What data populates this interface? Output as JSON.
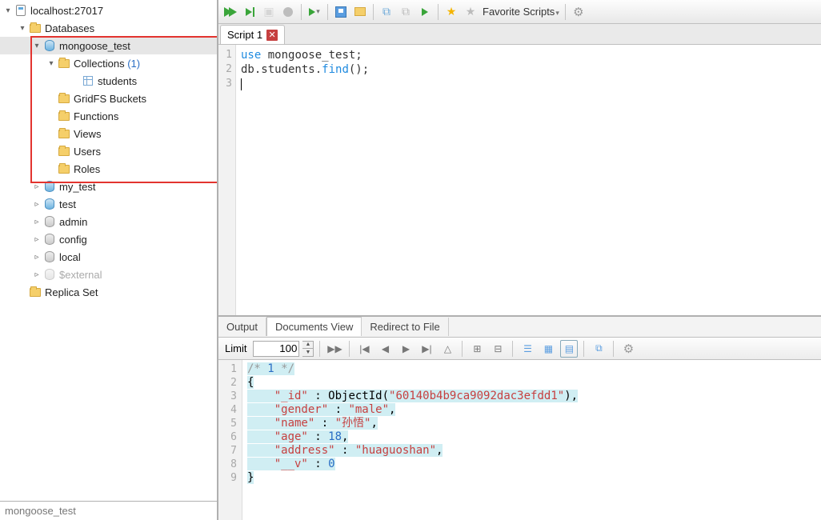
{
  "sidebar": {
    "root": {
      "label": "localhost:27017"
    },
    "databases_label": "Databases",
    "selected_db": "mongoose_test",
    "collections_label": "Collections",
    "collections_count": "(1)",
    "collection_items": [
      "students"
    ],
    "subfolders": [
      "GridFS Buckets",
      "Functions",
      "Views",
      "Users",
      "Roles"
    ],
    "other_dbs": [
      "my_test",
      "test",
      "admin",
      "config",
      "local",
      "$external"
    ],
    "replica_label": "Replica Set",
    "footer": "mongoose_test"
  },
  "toolbar": {
    "favorites_label": "Favorite Scripts"
  },
  "tabs": {
    "script_tab": "Script 1"
  },
  "editor": {
    "lines": [
      "1",
      "2",
      "3"
    ],
    "line1_a": "use",
    "line1_b": " mongoose_test;",
    "line2_a": "db.students.",
    "line2_b": "find",
    "line2_c": "();"
  },
  "lower_tabs": {
    "output": "Output",
    "docs": "Documents View",
    "redirect": "Redirect to File"
  },
  "limit": {
    "label": "Limit",
    "value": "100"
  },
  "result": {
    "gutter": [
      "1",
      "2",
      "3",
      "4",
      "5",
      "6",
      "7",
      "8",
      "9"
    ],
    "comment_a": "/* ",
    "comment_num": "1",
    "comment_b": " */",
    "brace_open": "{",
    "kv_id_k": "\"_id\"",
    "kv_id_sep": " : ObjectId(",
    "kv_id_v": "\"60140b4b9ca9092dac3efdd1\"",
    "kv_id_end": "),",
    "kv_gender_k": "\"gender\"",
    "kv_gender_v": "\"male\"",
    "kv_name_k": "\"name\"",
    "kv_name_v": "\"孙悟\"",
    "kv_age_k": "\"age\"",
    "kv_age_v": "18",
    "kv_address_k": "\"address\"",
    "kv_address_v": "\"huaguoshan\"",
    "kv_v_k": "\"__v\"",
    "kv_v_v": "0",
    "brace_close": "}",
    "colon": " : ",
    "comma": ","
  }
}
